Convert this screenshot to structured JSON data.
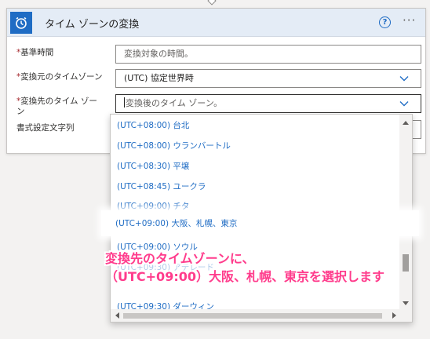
{
  "card": {
    "title": "タイム ゾーンの変換",
    "icon": "alarm-clock-icon",
    "help_icon": "?",
    "more_icon": "···"
  },
  "fields": {
    "base_time": {
      "required": "*",
      "label": "基準時間",
      "placeholder": "変換対象の時間。"
    },
    "source_tz": {
      "required": "*",
      "label": "変換元のタイムゾーン",
      "value": "(UTC) 協定世界時"
    },
    "dest_tz": {
      "required": "*",
      "label_line1": "変換先のタイム ゾー",
      "label_line2": "ン",
      "placeholder": "変換後のタイム ゾーン。"
    },
    "format_string": {
      "label": "書式設定文字列"
    }
  },
  "dropdown": {
    "options": [
      "(UTC+08:00) 台北",
      "(UTC+08:00) ウランバートル",
      "(UTC+08:30) 平壌",
      "(UTC+08:45) ユークラ",
      "(UTC+09:00) チタ",
      "(UTC+09:00) 大阪、札幌、東京",
      "(UTC+09:00) ソウル",
      "(UTC+09:30) アデレード",
      "(UTC+09:30) ダーウィン"
    ],
    "selected": "(UTC+09:00) 大阪、札幌、東京"
  },
  "annotation": {
    "line1": "変換先のタイムゾーンに、",
    "line2": "（UTC+09:00）大阪、札幌、東京を選択します"
  },
  "colors": {
    "accent": "#1f6cc4",
    "header_bg": "#e4ecf6",
    "annotation": "#ff3c8c",
    "required": "#a4262c"
  }
}
